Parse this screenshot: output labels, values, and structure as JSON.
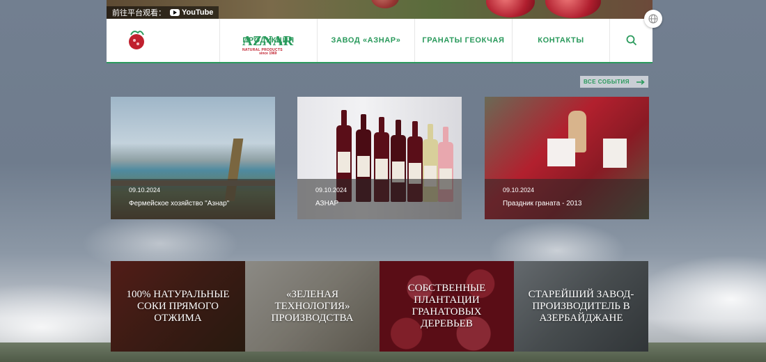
{
  "youtube_bar": {
    "text": "前往平台观看：",
    "brand": "YouTube"
  },
  "header": {
    "logo": {
      "brand": "AZNAR",
      "sub": "NATURAL PRODUCTS",
      "since": "since 1969"
    },
    "nav": [
      {
        "label": "ПРОДУКЦИЯ"
      },
      {
        "label": "ЗАВОД «АЗНАР»"
      },
      {
        "label": "ГРАНАТЫ ГЕОКЧАЯ"
      },
      {
        "label": "КОНТАКТЫ"
      }
    ]
  },
  "events": {
    "all_events_label": "ВСЕ СОБЫТИЯ",
    "cards": [
      {
        "date": "09.10.2024",
        "title": "Фермейское хозяйство \"Азнар\""
      },
      {
        "date": "09.10.2024",
        "title": "АЗНАР"
      },
      {
        "date": "09.10.2024",
        "title": "Праздник граната - 2013"
      }
    ]
  },
  "features": [
    {
      "label": "100% НАТУРАЛЬНЫЕ СОКИ ПРЯМОГО ОТЖИМА"
    },
    {
      "label": "«ЗЕЛЕНАЯ ТЕХНОЛОГИЯ» ПРОИЗВОДСТВА"
    },
    {
      "label": "СОБСТВЕННЫЕ ПЛАНТАЦИИ ГРАНАТОВЫХ ДЕРЕВЬЕВ"
    },
    {
      "label": "СТАРЕЙШИЙ ЗАВОД-ПРОИЗВОДИТЕЛЬ В АЗЕРБАЙДЖАНЕ"
    }
  ],
  "colors": {
    "brand_green": "#2a9a5c",
    "logo_red": "#c0202e"
  }
}
